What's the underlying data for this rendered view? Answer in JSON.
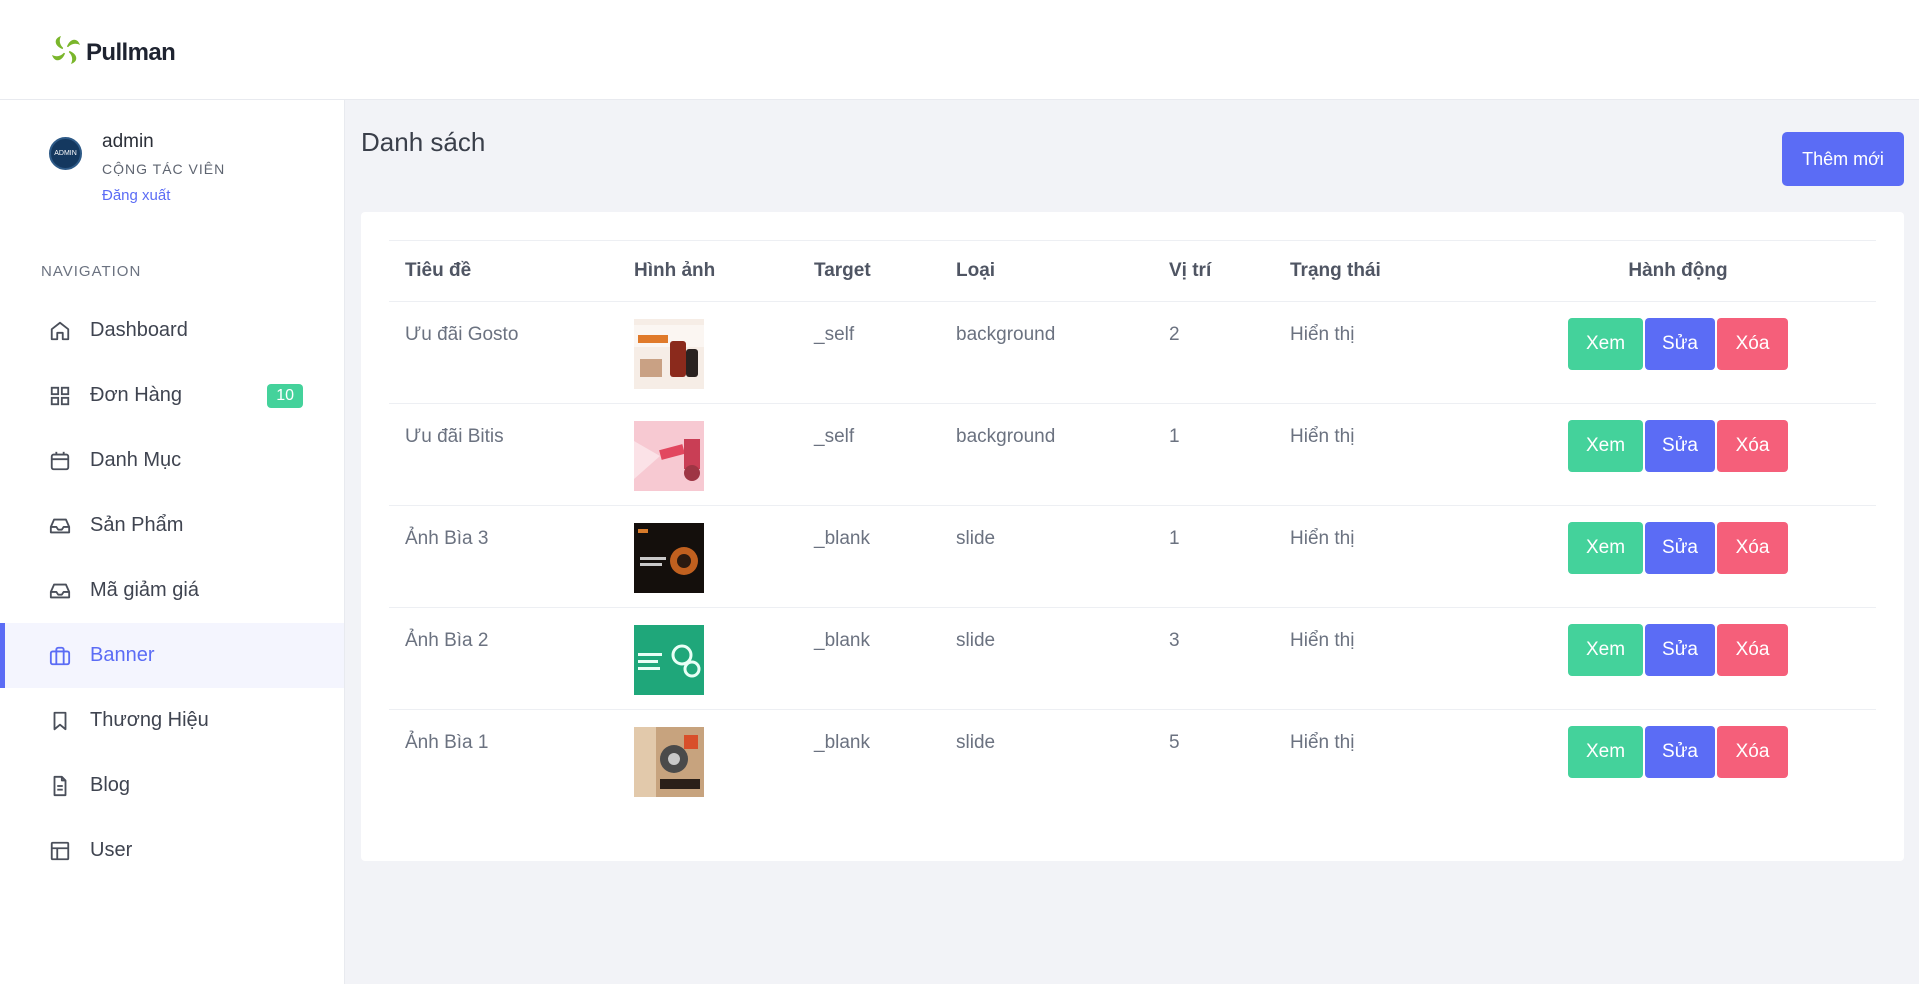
{
  "brand": {
    "name": "Pullman",
    "logo_icon": "leaf-swirl-icon",
    "logo_color": "#7ab62b"
  },
  "profile": {
    "avatar_text": "ADMIN",
    "name": "admin",
    "role": "CỘNG TÁC VIÊN",
    "logout_label": "Đăng xuất"
  },
  "nav": {
    "heading": "NAVIGATION",
    "items": [
      {
        "label": "Dashboard",
        "icon": "home-icon"
      },
      {
        "label": "Đơn Hàng",
        "icon": "grid-icon",
        "badge": "10"
      },
      {
        "label": "Danh Mục",
        "icon": "calendar-icon"
      },
      {
        "label": "Sản Phẩm",
        "icon": "inbox-icon"
      },
      {
        "label": "Mã giảm giá",
        "icon": "inbox-icon"
      },
      {
        "label": "Banner",
        "icon": "briefcase-icon",
        "active": true
      },
      {
        "label": "Thương Hiệu",
        "icon": "bookmark-icon"
      },
      {
        "label": "Blog",
        "icon": "file-text-icon"
      },
      {
        "label": "User",
        "icon": "layout-icon"
      }
    ]
  },
  "page": {
    "title": "Danh sách",
    "add_button": "Thêm mới"
  },
  "table": {
    "headers": [
      "Tiêu đề",
      "Hình ảnh",
      "Target",
      "Loại",
      "Vị trí",
      "Trạng thái",
      "Hành động"
    ],
    "actions": {
      "view": "Xem",
      "edit": "Sửa",
      "delete": "Xóa"
    },
    "rows": [
      {
        "title": "Ưu đãi Gosto",
        "image": "banner-thumbnail",
        "target": "_self",
        "type": "background",
        "position": "2",
        "status": "Hiển thị"
      },
      {
        "title": "Ưu đãi Bitis",
        "image": "banner-thumbnail",
        "target": "_self",
        "type": "background",
        "position": "1",
        "status": "Hiển thị"
      },
      {
        "title": "Ảnh Bìa 3",
        "image": "banner-thumbnail",
        "target": "_blank",
        "type": "slide",
        "position": "1",
        "status": "Hiển thị"
      },
      {
        "title": "Ảnh Bìa 2",
        "image": "banner-thumbnail",
        "target": "_blank",
        "type": "slide",
        "position": "3",
        "status": "Hiển thị"
      },
      {
        "title": "Ảnh Bìa 1",
        "image": "banner-thumbnail",
        "target": "_blank",
        "type": "slide",
        "position": "5",
        "status": "Hiển thị"
      }
    ]
  },
  "colors": {
    "accent": "#5b6cf5",
    "success": "#44d29b",
    "danger": "#f55f7a",
    "background": "#f2f3f7"
  }
}
